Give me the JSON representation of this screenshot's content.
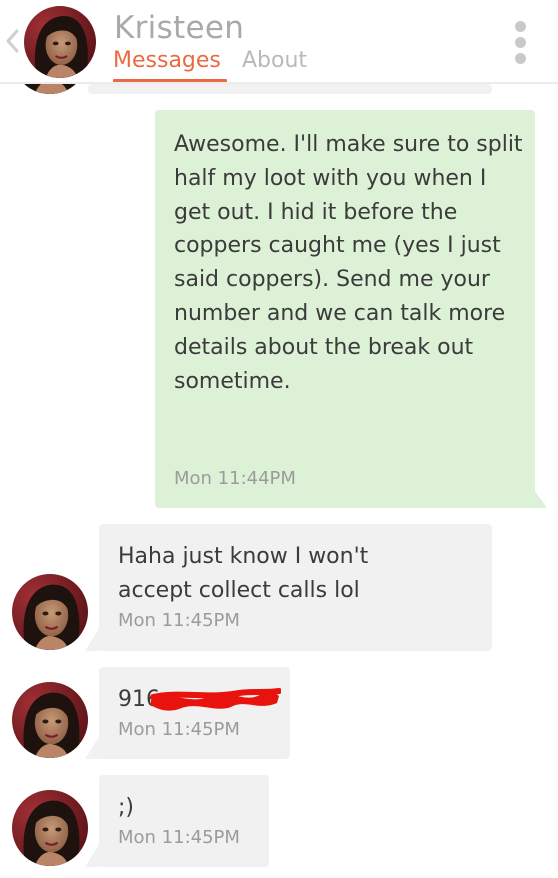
{
  "header": {
    "contact_name": "Kristeen",
    "tabs": [
      {
        "label": "Messages",
        "active": true
      },
      {
        "label": "About",
        "active": false
      }
    ]
  },
  "colors": {
    "accent": "#ea6a43",
    "outgoing_bubble": "#ddf1d6",
    "incoming_bubble": "#f1f1f1",
    "redaction": "#e8120f"
  },
  "messages": [
    {
      "direction": "outgoing",
      "text": "Awesome. I'll make sure to split half my loot with you when I get out. I hid it before the coppers caught me (yes I just said coppers). Send me your number and we can talk more details about the break out sometime.",
      "time": "Mon 11:44PM"
    },
    {
      "direction": "incoming",
      "text": "Haha just know I won't accept collect calls lol",
      "time": "Mon 11:45PM"
    },
    {
      "direction": "incoming",
      "text": "916",
      "redacted": true,
      "time": "Mon 11:45PM"
    },
    {
      "direction": "incoming",
      "text": ";)",
      "time": "Mon 11:45PM"
    }
  ]
}
